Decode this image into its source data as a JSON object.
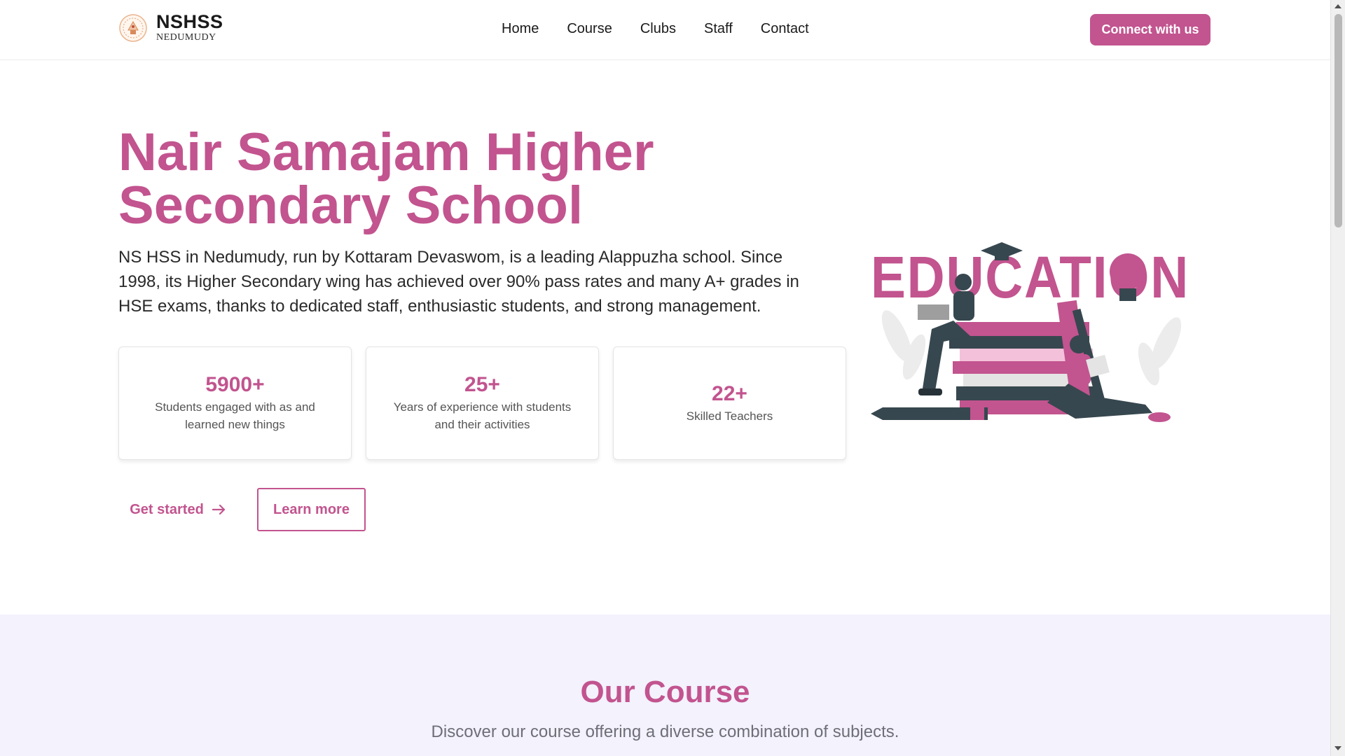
{
  "colors": {
    "accent": "#c2548f",
    "course_bg": "#f3f2fd"
  },
  "header": {
    "logo_title": "NSHSS",
    "logo_subtitle": "NEDUMUDY",
    "logo_icon": "school-emblem-icon",
    "nav": [
      {
        "label": "Home"
      },
      {
        "label": "Course"
      },
      {
        "label": "Clubs"
      },
      {
        "label": "Staff"
      },
      {
        "label": "Contact"
      }
    ],
    "cta_label": "Connect with us"
  },
  "hero": {
    "title": "Nair Samajam Higher Secondary School",
    "description": "NS HSS in Nedumudy, run by Kottaram Devaswom, is a leading Alappuzha school. Since 1998, its Higher Secondary wing has achieved over 90% pass rates and many A+ grades in HSE exams, thanks to dedicated staff, enthusiastic students, and strong management.",
    "stats": [
      {
        "value": "5900+",
        "label": "Students engaged with as and learned new things"
      },
      {
        "value": "25+",
        "label": "Years of experience with students and their activities"
      },
      {
        "value": "22+",
        "label": "Skilled Teachers"
      }
    ],
    "get_started_label": "Get started",
    "learn_more_label": "Learn more",
    "illustration_word": "EDUCATION"
  },
  "course": {
    "title": "Our Course",
    "subtitle": "Discover our course offering a diverse combination of subjects."
  }
}
